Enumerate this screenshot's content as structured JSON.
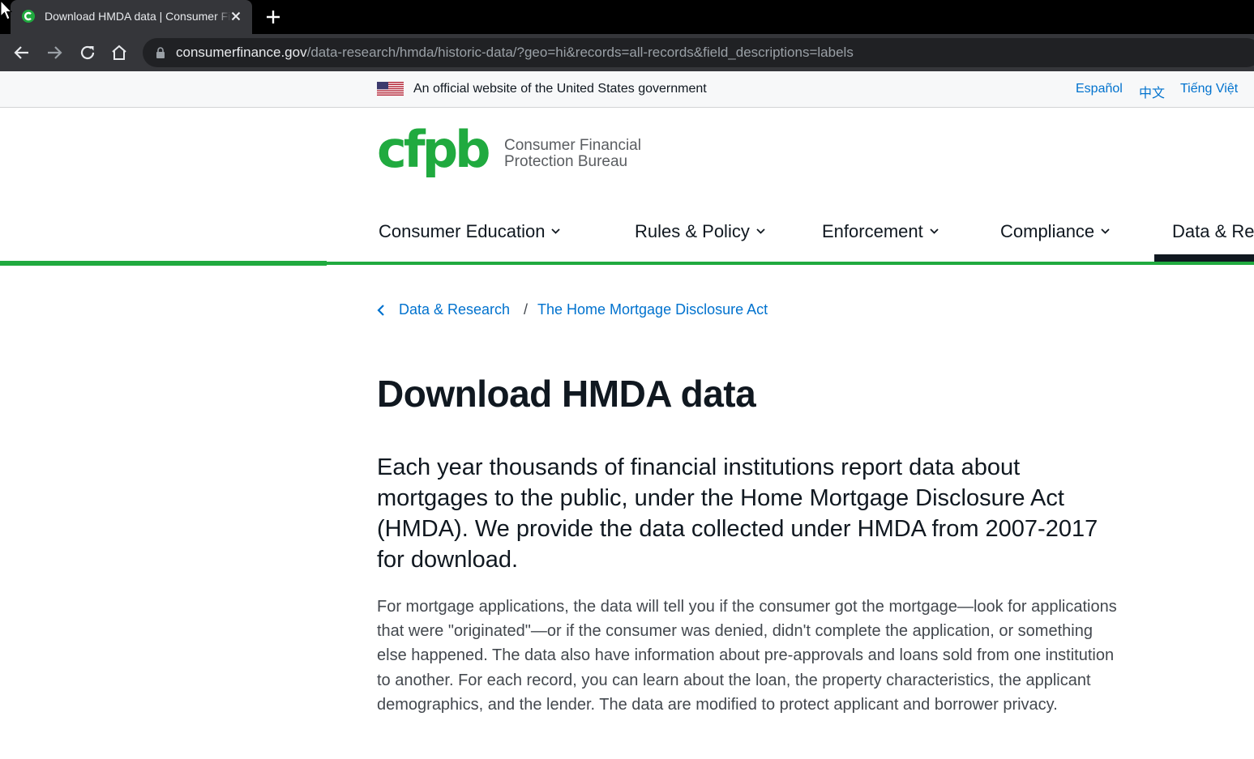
{
  "browser": {
    "tab_title": "Download HMDA data | Consumer Financial Protection Bureau",
    "url_host": "consumerfinance.gov",
    "url_path": "/data-research/hmda/historic-data/?geo=hi&records=all-records&field_descriptions=labels"
  },
  "gov_banner": {
    "text": "An official website of the United States government",
    "languages": [
      "Español",
      "中文",
      "Tiếng Việt"
    ]
  },
  "header": {
    "logo_letters": "cfpb",
    "logo_line1": "Consumer Financial",
    "logo_line2": "Protection Bureau"
  },
  "nav": {
    "items": [
      "Consumer Education",
      "Rules & Policy",
      "Enforcement",
      "Compliance",
      "Data & Res"
    ]
  },
  "breadcrumb": {
    "items": [
      "Data & Research",
      "The Home Mortgage Disclosure Act"
    ],
    "separator": "/"
  },
  "page": {
    "title": "Download HMDA data",
    "lead": "Each year thousands of financial institutions report data about mortgages to the public, under the Home Mortgage Disclosure Act (HMDA). We provide the data collected under HMDA from 2007-2017 for download.",
    "body": "For mortgage applications, the data will tell you if the consumer got the mortgage—look for applications that were \"originated\"—or if the consumer was denied, didn't complete the application, or something else happened. The data also have information about pre-approvals and loans sold from one institution to another. For each record, you can learn about the loan, the property characteristics, the applicant demographics, and the lender. The data are modified to protect applicant and borrower privacy."
  },
  "colors": {
    "brand_green": "#20aa3f",
    "link_blue": "#0072ce",
    "text_dark": "#101820"
  }
}
